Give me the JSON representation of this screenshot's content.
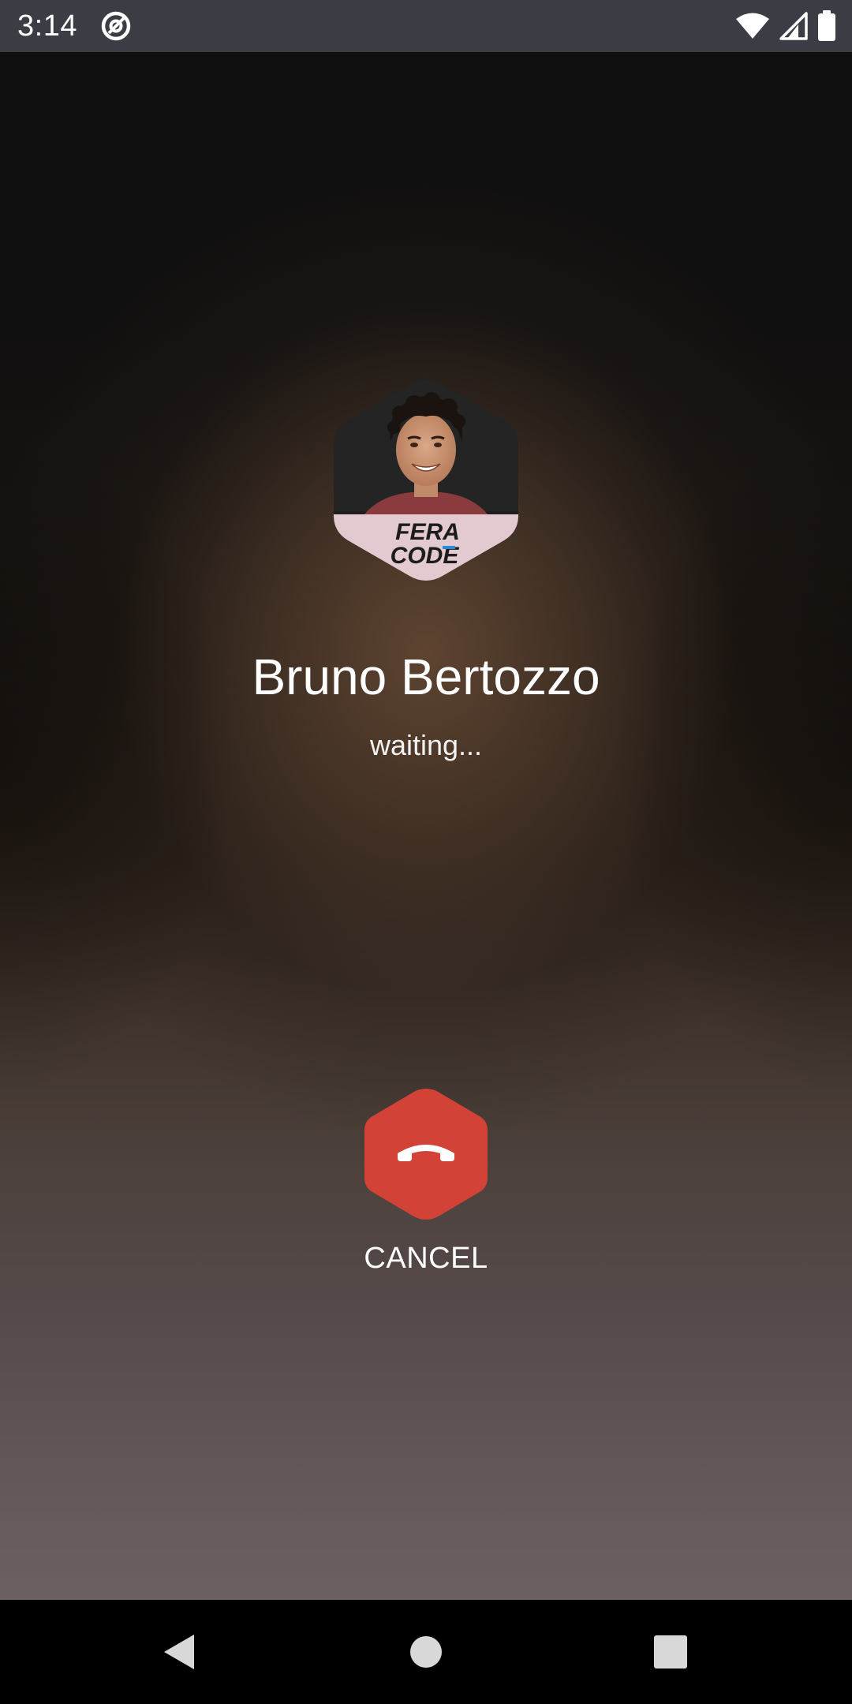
{
  "status_bar": {
    "time": "3:14",
    "left_icon": "vpn-key-icon",
    "right_icons": [
      "wifi-icon",
      "cell-signal-icon",
      "battery-icon"
    ]
  },
  "call": {
    "caller_name": "Bruno Bertozzo",
    "status": "waiting...",
    "avatar_logo_line1": "FERA",
    "avatar_logo_line2": "CODE",
    "cancel_label": "CANCEL",
    "cancel_icon": "call-end-icon",
    "cancel_color": "#d24236"
  },
  "nav_bar": {
    "buttons": [
      "back-icon",
      "home-icon",
      "recents-icon"
    ]
  }
}
